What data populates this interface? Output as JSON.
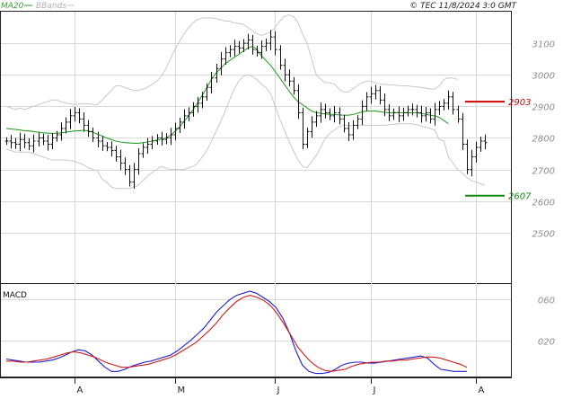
{
  "copyright": "© TEC 11/8/2024 3:0 GMT",
  "legend": [
    {
      "label": "MA20",
      "color": "#2e9f2e"
    },
    {
      "label": "BBands",
      "color": "#c8c8c8"
    }
  ],
  "colors": {
    "price": "#111111",
    "ma20": "#2e9f2e",
    "bbands": "#c8c8c8",
    "macd": "#2020d0",
    "signal": "#d01c1c",
    "resistance": "#cc0000",
    "support": "#118811",
    "grid": "#d9d9d9",
    "axis": "#222222"
  },
  "macd_label": "MACD",
  "chart_data": [
    {
      "type": "line",
      "subtype": "ohlc-bars",
      "title": "",
      "xlabel": "",
      "ylabel": "",
      "ylim": [
        2340,
        3200
      ],
      "yticks": [
        2500,
        2600,
        2700,
        2800,
        2900,
        3000,
        3100
      ],
      "ytick_labels": [
        "2500",
        "2600",
        "2700",
        "2800",
        "2900",
        "3000",
        "3100"
      ],
      "x_months": [
        {
          "label": "A",
          "index": 15
        },
        {
          "label": "M",
          "index": 37
        },
        {
          "label": "J",
          "index": 59
        },
        {
          "label": "J",
          "index": 80
        },
        {
          "label": "A",
          "index": 103
        }
      ],
      "levels": [
        {
          "label": "2903",
          "value": 2915,
          "color": "#cc0000"
        },
        {
          "label": "2607",
          "value": 2617,
          "color": "#118811"
        }
      ],
      "close": [
        2790,
        2785,
        2780,
        2795,
        2785,
        2775,
        2790,
        2800,
        2790,
        2780,
        2800,
        2810,
        2830,
        2850,
        2870,
        2880,
        2860,
        2840,
        2820,
        2800,
        2790,
        2775,
        2770,
        2760,
        2740,
        2720,
        2700,
        2660,
        2700,
        2750,
        2770,
        2780,
        2790,
        2800,
        2795,
        2800,
        2810,
        2830,
        2850,
        2870,
        2880,
        2900,
        2910,
        2930,
        2960,
        2990,
        3020,
        3050,
        3070,
        3080,
        3090,
        3085,
        3100,
        3110,
        3080,
        3070,
        3090,
        3100,
        3120,
        3080,
        3030,
        3000,
        2980,
        2950,
        2880,
        2780,
        2820,
        2850,
        2870,
        2890,
        2880,
        2870,
        2880,
        2860,
        2830,
        2810,
        2840,
        2860,
        2900,
        2930,
        2940,
        2950,
        2920,
        2890,
        2870,
        2880,
        2870,
        2880,
        2890,
        2890,
        2880,
        2870,
        2880,
        2860,
        2890,
        2900,
        2910,
        2930,
        2890,
        2860,
        2780,
        2700,
        2740,
        2770,
        2790,
        2785
      ],
      "bb_upper": [
        2900,
        2895,
        2890,
        2895,
        2890,
        2895,
        2900,
        2905,
        2910,
        2915,
        2920,
        2920,
        2915,
        2910,
        2908,
        2906,
        2907,
        2908,
        2908,
        2906,
        2905,
        2920,
        2935,
        2950,
        2965,
        2965,
        2960,
        2955,
        2950,
        2950,
        2955,
        2960,
        2970,
        2980,
        2995,
        3020,
        3050,
        3080,
        3105,
        3130,
        3150,
        3165,
        3175,
        3180,
        3180,
        3180,
        3178,
        3175,
        3170,
        3170,
        3165,
        3162,
        3160,
        3150,
        3140,
        3130,
        3125,
        3130,
        3135,
        3150,
        3170,
        3185,
        3190,
        3185,
        3165,
        3130,
        3100,
        3050,
        3000,
        2985,
        2975,
        2975,
        2970,
        2955,
        2945,
        2945,
        2955,
        2965,
        2975,
        2980,
        2980,
        2975,
        2970,
        2970,
        2968,
        2968,
        2966,
        2965,
        2965,
        2963,
        2962,
        2960,
        2958,
        2955,
        2955,
        2965,
        2985,
        2990,
        2990,
        2985
      ],
      "bb_lower": [
        2765,
        2760,
        2755,
        2755,
        2755,
        2755,
        2750,
        2745,
        2740,
        2735,
        2730,
        2730,
        2730,
        2730,
        2728,
        2726,
        2720,
        2715,
        2705,
        2700,
        2695,
        2670,
        2660,
        2645,
        2640,
        2640,
        2640,
        2640,
        2645,
        2650,
        2665,
        2680,
        2690,
        2700,
        2710,
        2705,
        2700,
        2700,
        2700,
        2700,
        2705,
        2710,
        2720,
        2740,
        2760,
        2790,
        2820,
        2850,
        2885,
        2920,
        2955,
        2980,
        2995,
        3000,
        2995,
        2985,
        2970,
        2960,
        2940,
        2900,
        2860,
        2825,
        2790,
        2760,
        2730,
        2710,
        2705,
        2725,
        2745,
        2770,
        2800,
        2815,
        2825,
        2835,
        2840,
        2840,
        2840,
        2840,
        2840,
        2840,
        2840,
        2840,
        2840,
        2840,
        2842,
        2843,
        2845,
        2845,
        2845,
        2845,
        2842,
        2838,
        2834,
        2830,
        2825,
        2795,
        2790,
        2740,
        2720,
        2700,
        2690,
        2675,
        2665,
        2660,
        2655,
        2650
      ],
      "ma20": [
        2830,
        2828,
        2827,
        2825,
        2823,
        2822,
        2820,
        2818,
        2816,
        2815,
        2814,
        2815,
        2816,
        2818,
        2820,
        2822,
        2823,
        2824,
        2822,
        2818,
        2812,
        2806,
        2800,
        2795,
        2790,
        2787,
        2785,
        2784,
        2783,
        2783,
        2785,
        2787,
        2790,
        2793,
        2796,
        2800,
        2808,
        2820,
        2835,
        2852,
        2870,
        2890,
        2912,
        2935,
        2960,
        2985,
        3005,
        3020,
        3035,
        3045,
        3055,
        3065,
        3075,
        3085,
        3090,
        3080,
        3060,
        3045,
        3030,
        3010,
        2990,
        2970,
        2950,
        2930,
        2915,
        2905,
        2895,
        2885,
        2880,
        2878,
        2876,
        2875,
        2874,
        2873,
        2872,
        2872,
        2874,
        2878,
        2882,
        2885,
        2885,
        2885,
        2883,
        2881,
        2880,
        2880,
        2880,
        2880,
        2880,
        2880,
        2880,
        2878,
        2875,
        2872,
        2870,
        2865,
        2855,
        2845
      ]
    },
    {
      "type": "line",
      "title": "MACD",
      "xlabel": "",
      "ylabel": "",
      "ylim": [
        -15,
        75
      ],
      "yticks": [
        20,
        60
      ],
      "ytick_labels": [
        "020",
        "060"
      ],
      "series": [
        {
          "role": "macd",
          "values": [
            2,
            1,
            0,
            -1,
            -1,
            -1,
            0,
            1,
            3,
            6,
            9,
            11,
            10,
            6,
            0,
            -6,
            -10,
            -10,
            -8,
            -5,
            -3,
            -1,
            0,
            2,
            4,
            6,
            10,
            15,
            20,
            26,
            32,
            40,
            48,
            54,
            60,
            64,
            66,
            68,
            66,
            62,
            58,
            52,
            42,
            28,
            10,
            -4,
            -10,
            -12,
            -12,
            -11,
            -8,
            -4,
            -2,
            -1,
            -1,
            -2,
            -2,
            -1,
            0,
            1,
            2,
            3,
            4,
            5,
            3,
            -3,
            -8,
            -9,
            -10,
            -10,
            -10
          ]
        },
        {
          "role": "signal",
          "values": [
            0,
            0,
            -1,
            -1,
            0,
            1,
            2,
            4,
            6,
            8,
            9,
            8,
            6,
            4,
            1,
            -2,
            -4,
            -6,
            -6,
            -5,
            -4,
            -3,
            -1,
            1,
            3,
            6,
            10,
            14,
            18,
            24,
            30,
            37,
            45,
            52,
            58,
            62,
            64,
            62,
            59,
            54,
            46,
            36,
            25,
            14,
            6,
            -1,
            -6,
            -9,
            -10,
            -9,
            -8,
            -5,
            -3,
            -2,
            -1,
            -1,
            0,
            0,
            1,
            1,
            2,
            3,
            4,
            4,
            3,
            1,
            -1,
            -3,
            -6
          ]
        }
      ]
    }
  ]
}
